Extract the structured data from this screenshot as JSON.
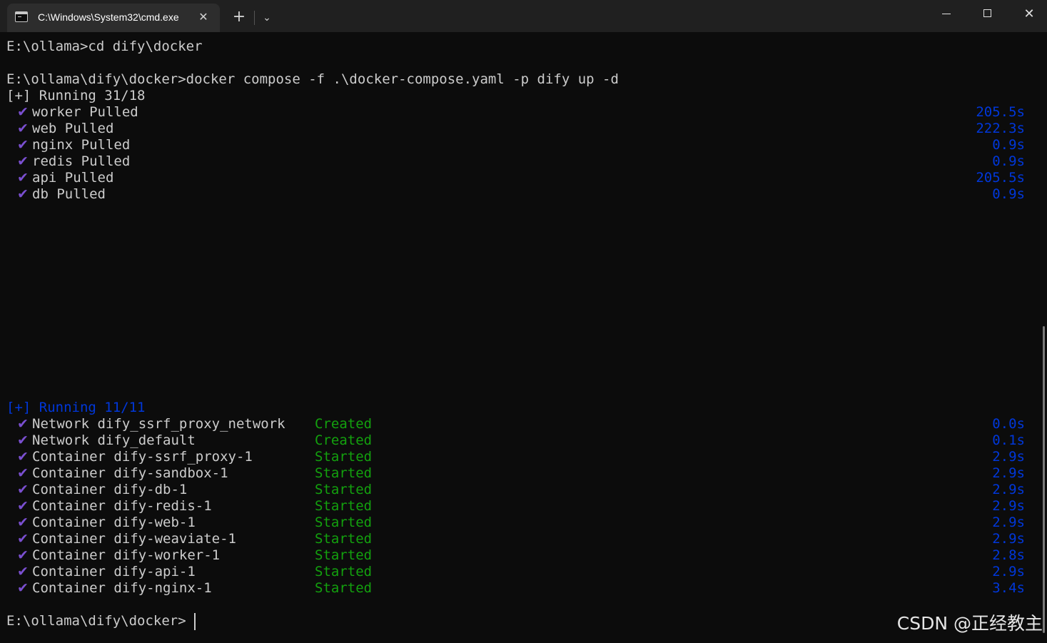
{
  "window": {
    "tab_title": "C:\\Windows\\System32\\cmd.exe",
    "tab_close": "✕",
    "new_tab": "+",
    "dropdown": "⌄",
    "close_glyph": "✕"
  },
  "terminal": {
    "lines": {
      "cd_cmd": "E:\\ollama>cd dify\\docker",
      "compose_cmd": "E:\\ollama\\dify\\docker>docker compose -f .\\docker-compose.yaml -p dify up -d",
      "pull_header": "[+] Running 31/18",
      "run_header": "[+] Running 11/11",
      "prompt": "E:\\ollama\\dify\\docker>"
    },
    "check_glyph": "✔",
    "pulls": [
      {
        "name": "worker Pulled",
        "time": "205.5s"
      },
      {
        "name": "web Pulled",
        "time": "222.3s"
      },
      {
        "name": "nginx Pulled",
        "time": "0.9s"
      },
      {
        "name": "redis Pulled",
        "time": "0.9s"
      },
      {
        "name": "api Pulled",
        "time": "205.5s"
      },
      {
        "name": "db Pulled",
        "time": "0.9s"
      }
    ],
    "resources": [
      {
        "name": "Network dify_ssrf_proxy_network",
        "status": "Created",
        "time": "0.0s"
      },
      {
        "name": "Network dify_default",
        "status": "Created",
        "time": "0.1s"
      },
      {
        "name": "Container dify-ssrf_proxy-1",
        "status": "Started",
        "time": "2.9s"
      },
      {
        "name": "Container dify-sandbox-1",
        "status": "Started",
        "time": "2.9s"
      },
      {
        "name": "Container dify-db-1",
        "status": "Started",
        "time": "2.9s"
      },
      {
        "name": "Container dify-redis-1",
        "status": "Started",
        "time": "2.9s"
      },
      {
        "name": "Container dify-web-1",
        "status": "Started",
        "time": "2.9s"
      },
      {
        "name": "Container dify-weaviate-1",
        "status": "Started",
        "time": "2.9s"
      },
      {
        "name": "Container dify-worker-1",
        "status": "Started",
        "time": "2.8s"
      },
      {
        "name": "Container dify-api-1",
        "status": "Started",
        "time": "2.9s"
      },
      {
        "name": "Container dify-nginx-1",
        "status": "Started",
        "time": "3.4s"
      }
    ],
    "watermark": "CSDN @正经教主"
  },
  "colors": {
    "background": "#0c0c0c",
    "text": "#cccccc",
    "check": "#7a4fd0",
    "status_green": "#13a10e",
    "time_blue": "#0037da"
  }
}
